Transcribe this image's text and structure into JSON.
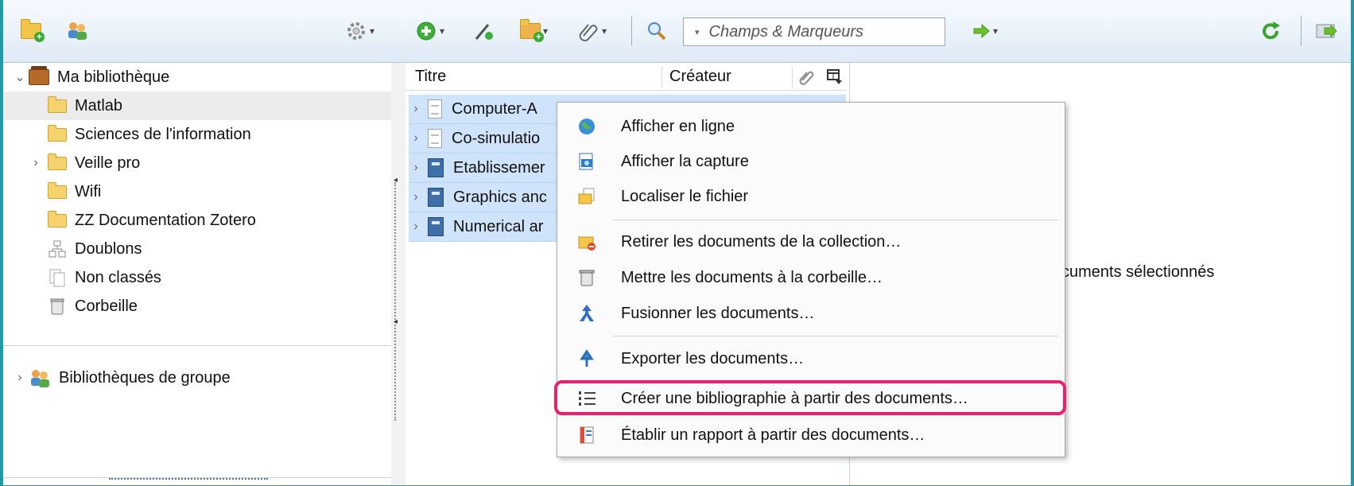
{
  "toolbar": {
    "search_placeholder": "Champs & Marqueurs",
    "dropdown_glyph": "▾"
  },
  "sidebar": {
    "library_label": "Ma bibliothèque",
    "items": [
      {
        "label": "Matlab",
        "icon": "folder-icon"
      },
      {
        "label": "Sciences de l'information",
        "icon": "folder-icon"
      },
      {
        "label": "Veille pro",
        "icon": "folder-icon"
      },
      {
        "label": "Wifi",
        "icon": "folder-icon"
      },
      {
        "label": "ZZ Documentation Zotero",
        "icon": "folder-icon"
      },
      {
        "label": "Doublons",
        "icon": "duplicates-icon"
      },
      {
        "label": "Non classés",
        "icon": "unfiled-icon"
      },
      {
        "label": "Corbeille",
        "icon": "trash-icon"
      }
    ],
    "group_label": "Bibliothèques de groupe"
  },
  "items": {
    "columns": {
      "title": "Titre",
      "creator": "Créateur"
    },
    "rows": [
      {
        "title": "Computer-A",
        "icon": "document-icon"
      },
      {
        "title": "Co-simulatio",
        "icon": "document-icon"
      },
      {
        "title": "Etablissemer",
        "icon": "book-icon"
      },
      {
        "title": "Graphics anc",
        "icon": "book-icon"
      },
      {
        "title": "Numerical ar",
        "icon": "book-icon"
      }
    ]
  },
  "info": {
    "text": "cuments sélectionnés"
  },
  "context_menu": {
    "items": [
      {
        "label": "Afficher en ligne",
        "icon": "globe-icon"
      },
      {
        "label": "Afficher la capture",
        "icon": "snapshot-icon"
      },
      {
        "label": "Localiser le fichier",
        "icon": "locate-file-icon"
      },
      {
        "label": "Retirer les documents de la collection…",
        "icon": "remove-from-collection-icon"
      },
      {
        "label": "Mettre les documents à la corbeille…",
        "icon": "trash-icon"
      },
      {
        "label": "Fusionner les documents…",
        "icon": "merge-icon"
      },
      {
        "label": "Exporter les documents…",
        "icon": "export-icon"
      },
      {
        "label": "Créer une bibliographie à partir des documents…",
        "icon": "bibliography-list-icon"
      },
      {
        "label": "Établir un rapport à partir des documents…",
        "icon": "report-icon"
      }
    ],
    "highlighted_index": 7
  },
  "colors": {
    "highlight_border": "#e5226b",
    "selection_bg": "#cfe4fb",
    "frame_accent": "#1f9aa6"
  }
}
